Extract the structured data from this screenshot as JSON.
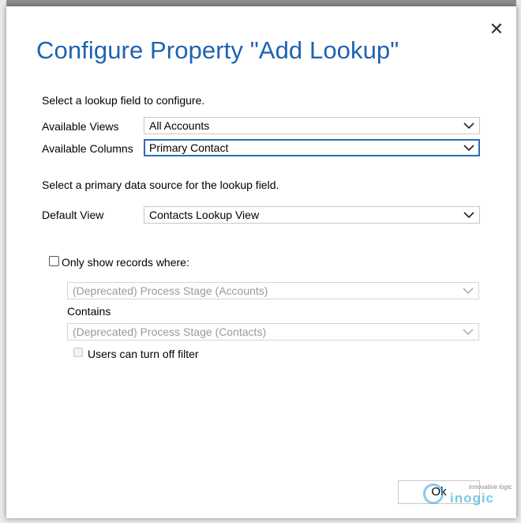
{
  "dialog": {
    "title": "Configure Property \"Add Lookup\"",
    "close_icon": "close-icon"
  },
  "section1": {
    "heading": "Select a lookup field to configure.",
    "available_views": {
      "label": "Available Views",
      "value": "All Accounts"
    },
    "available_columns": {
      "label": "Available Columns",
      "value": "Primary Contact"
    }
  },
  "section2": {
    "heading": "Select a primary data source for the lookup field.",
    "default_view": {
      "label": "Default View",
      "value": "Contacts Lookup View"
    }
  },
  "filter": {
    "only_show_label": "Only show records where:",
    "only_show_checked": false,
    "first_field_value": "(Deprecated) Process Stage (Accounts)",
    "contains_label": "Contains",
    "second_field_value": "(Deprecated) Process Stage (Contacts)",
    "users_can_turn_off_label": "Users can turn off filter",
    "users_can_turn_off_checked": false
  },
  "footer": {
    "ok_label": "Ok",
    "watermark_brand": "inogic",
    "watermark_tagline": "innovative logic"
  },
  "colors": {
    "title": "#1f63b2",
    "focus_border": "#2c6bb6",
    "watermark": "#2aa3d8"
  }
}
